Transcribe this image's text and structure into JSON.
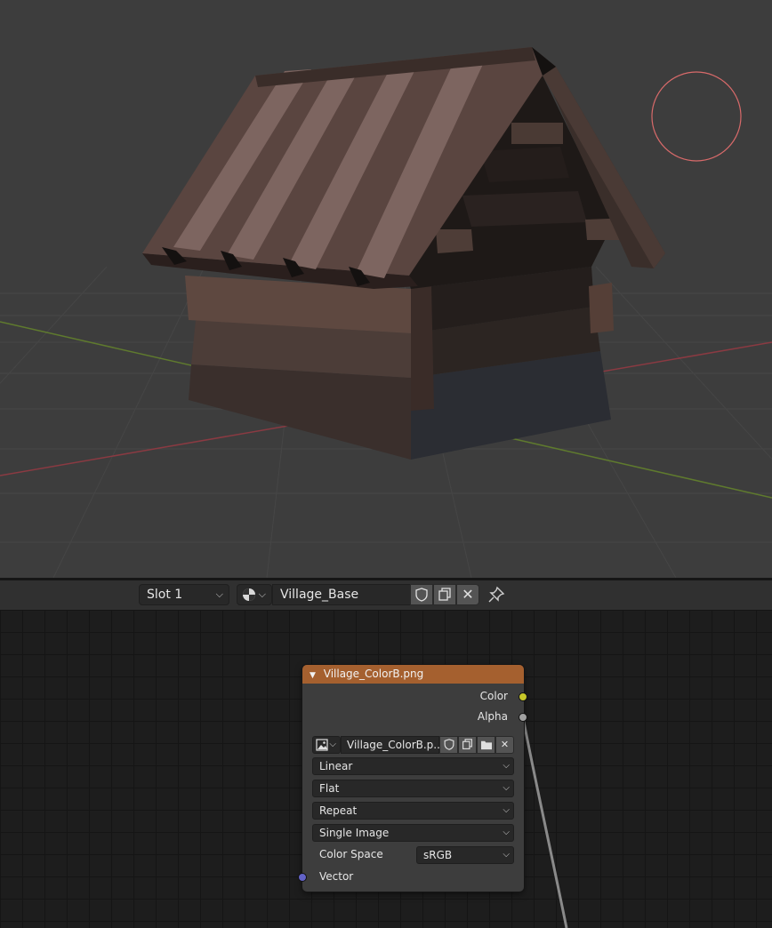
{
  "header": {
    "slot_label": "Slot 1",
    "material_name": "Village_Base"
  },
  "icons": [
    "material-sphere-icon",
    "fake-user-shield-icon",
    "duplicate-icon",
    "unlink-close-icon",
    "pin-icon",
    "image-icon",
    "open-folder-icon"
  ],
  "node": {
    "title": "Village_ColorB.png",
    "outputs": [
      {
        "label": "Color",
        "color": "#c7c729"
      },
      {
        "label": "Alpha",
        "color": "#a1a1a1"
      }
    ],
    "image_name": "Village_ColorB.p..",
    "interpolation": "Linear",
    "projection": "Flat",
    "extension": "Repeat",
    "source": "Single Image",
    "color_space_label": "Color Space",
    "color_space": "sRGB",
    "input_label": "Vector",
    "input_color": "#6363c7",
    "header_color": "#a5602f"
  }
}
